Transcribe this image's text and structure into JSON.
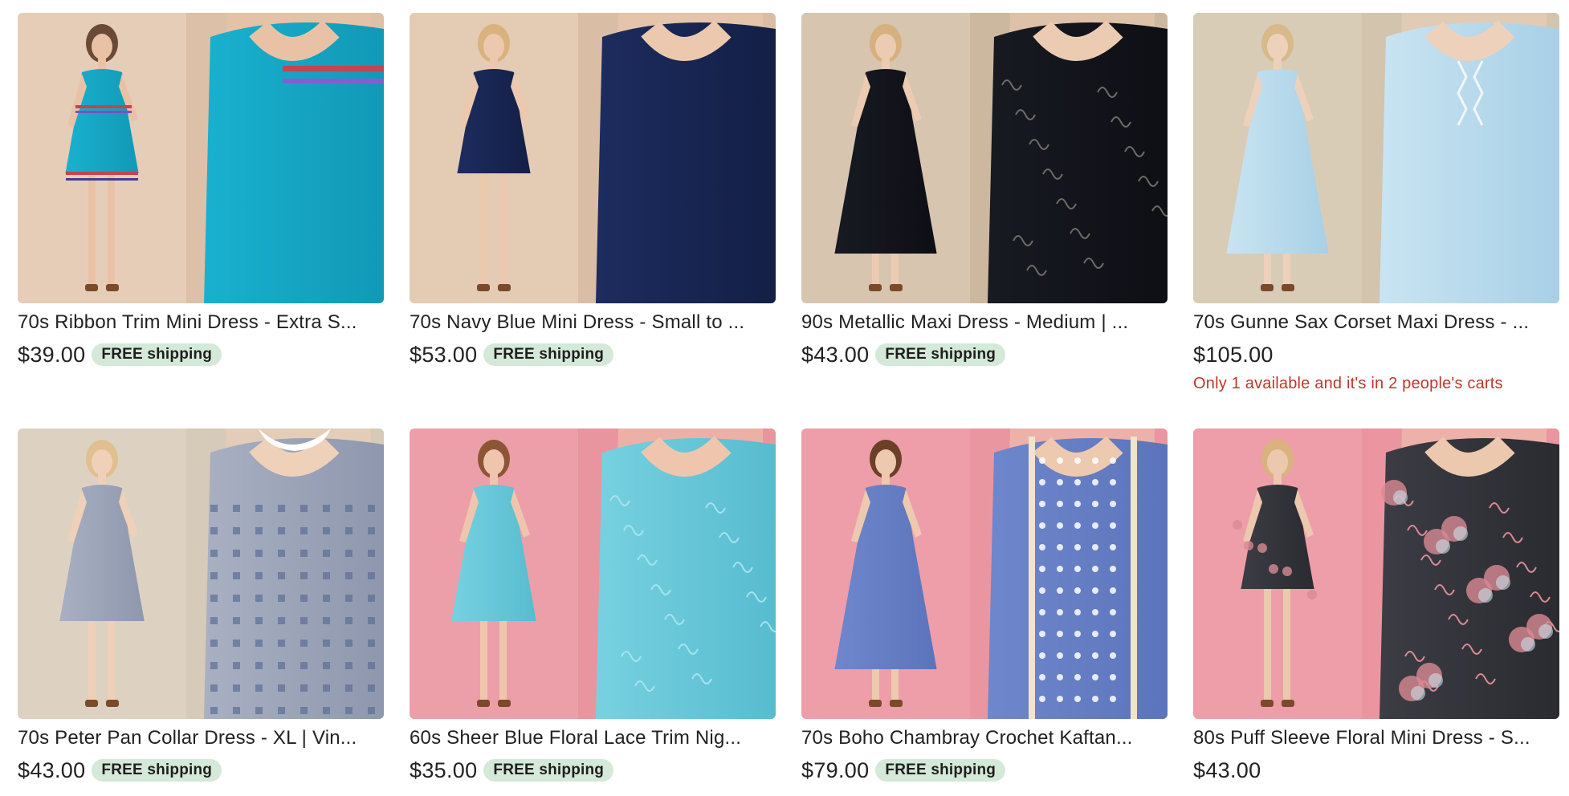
{
  "listings": [
    {
      "title": "70s Ribbon Trim Mini Dress - Extra S...",
      "price": "$39.00",
      "badge": "FREE shipping",
      "note": "",
      "image": {
        "bg_left": "#e6cdb8",
        "bg_right": "#dcc0a8",
        "dress": "#19b1cf",
        "dress_dark": "#1199b6",
        "trim": "#c6434f",
        "skin": "#e9c2a6",
        "hair": "#6a4a36",
        "style": "mini"
      }
    },
    {
      "title": "70s Navy Blue Mini Dress - Small to ...",
      "price": "$53.00",
      "badge": "FREE shipping",
      "note": "",
      "image": {
        "bg_left": "#e4cbb4",
        "bg_right": "#d9bea5",
        "dress": "#1d2c5f",
        "dress_dark": "#131f45",
        "trim": "#2c3d7a",
        "skin": "#ecc8ae",
        "hair": "#d9b27d",
        "style": "mini"
      }
    },
    {
      "title": "90s Metallic Maxi Dress - Medium | ...",
      "price": "$43.00",
      "badge": "FREE shipping",
      "note": "",
      "image": {
        "bg_left": "#d7c5af",
        "bg_right": "#ccb79f",
        "dress": "#181a22",
        "dress_dark": "#0e0f15",
        "trim": "#6e6a66",
        "skin": "#ebcbb1",
        "hair": "#d6b07f",
        "style": "maxi"
      }
    },
    {
      "title": "70s Gunne Sax Corset Maxi Dress - ...",
      "price": "$105.00",
      "badge": "",
      "note": "Only 1 available and it's in 2 people's carts",
      "image": {
        "bg_left": "#d8ccb7",
        "bg_right": "#d2c4ad",
        "dress": "#c9e4f2",
        "dress_dark": "#a8d0e6",
        "trim": "#f3f6f7",
        "skin": "#edd1bb",
        "hair": "#d8b98a",
        "style": "maxi"
      }
    },
    {
      "title": "70s Peter Pan Collar Dress - XL | Vin...",
      "price": "$43.00",
      "badge": "FREE shipping",
      "note": "",
      "image": {
        "bg_left": "#ddd2c2",
        "bg_right": "#d6cab8",
        "dress": "#a9b0c2",
        "dress_dark": "#8e97ad",
        "trim": "#ffffff",
        "skin": "#efd0b9",
        "hair": "#e0bf90",
        "style": "midi"
      }
    },
    {
      "title": "60s Sheer Blue Floral Lace Trim Nig...",
      "price": "$35.00",
      "badge": "FREE shipping",
      "note": "",
      "image": {
        "bg_left": "#ec9fa8",
        "bg_right": "#e8959f",
        "dress": "#77d1e0",
        "dress_dark": "#57bccf",
        "trim": "#a6e3ee",
        "skin": "#efc6ad",
        "hair": "#8c5535",
        "style": "midi"
      }
    },
    {
      "title": "70s Boho Chambray Crochet Kaftan...",
      "price": "$79.00",
      "badge": "FREE shipping",
      "note": "",
      "image": {
        "bg_left": "#ee9ea8",
        "bg_right": "#ea96a1",
        "dress": "#6f87cc",
        "dress_dark": "#5b74bb",
        "trim": "#efe4cc",
        "skin": "#edc9b0",
        "hair": "#6b3f28",
        "style": "maxi"
      }
    },
    {
      "title": "80s Puff Sleeve Floral Mini Dress - S...",
      "price": "$43.00",
      "badge": "",
      "note": "",
      "image": {
        "bg_left": "#ee9ea8",
        "bg_right": "#ea95a0",
        "dress": "#3c3d44",
        "dress_dark": "#2a2b31",
        "trim": "#d98a93",
        "skin": "#ecc8ae",
        "hair": "#d9b27d",
        "style": "mini"
      }
    }
  ]
}
